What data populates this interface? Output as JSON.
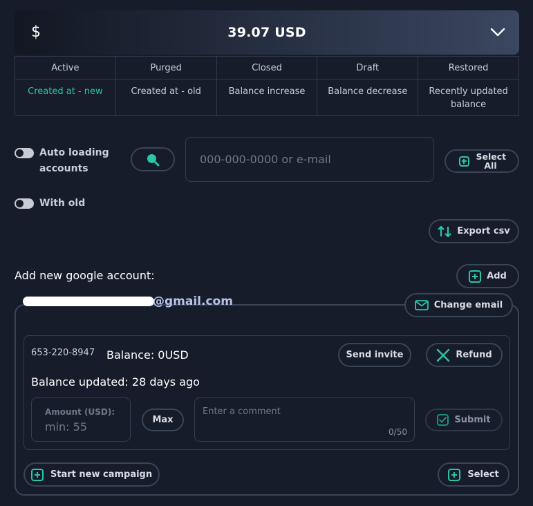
{
  "balance": {
    "currency_symbol": "$",
    "amount": "39.07 USD"
  },
  "filters": {
    "status": [
      "Active",
      "Purged",
      "Closed",
      "Draft",
      "Restored"
    ],
    "sort": [
      "Created at - new",
      "Created at - old",
      "Balance increase",
      "Balance decrease",
      "Recently updated balance"
    ],
    "active_sort_index": 0
  },
  "toggles": {
    "auto_loading": "Auto loading accounts",
    "with_old": "With old"
  },
  "search": {
    "placeholder": "000-000-0000 or e-mail"
  },
  "buttons": {
    "select_all": "Select All",
    "export_csv": "Export csv",
    "add": "Add",
    "change_email": "Change email",
    "send_invite": "Send invite",
    "refund": "Refund",
    "max": "Max",
    "submit": "Submit",
    "start_campaign": "Start new campaign",
    "select": "Select"
  },
  "add_account_label": "Add new google account:",
  "account": {
    "email_visible": "@gmail.com",
    "phone": "653-220-8947",
    "balance": "Balance: 0USD",
    "balance_updated": "Balance updated: 28 days ago",
    "amount_label": "Amount (USD):",
    "amount_placeholder": "min: 55",
    "comment_placeholder": "Enter a comment",
    "comment_counter": "0/50"
  },
  "colors": {
    "accent": "#2bc5a8",
    "background": "#161c29",
    "border": "#343e52"
  }
}
